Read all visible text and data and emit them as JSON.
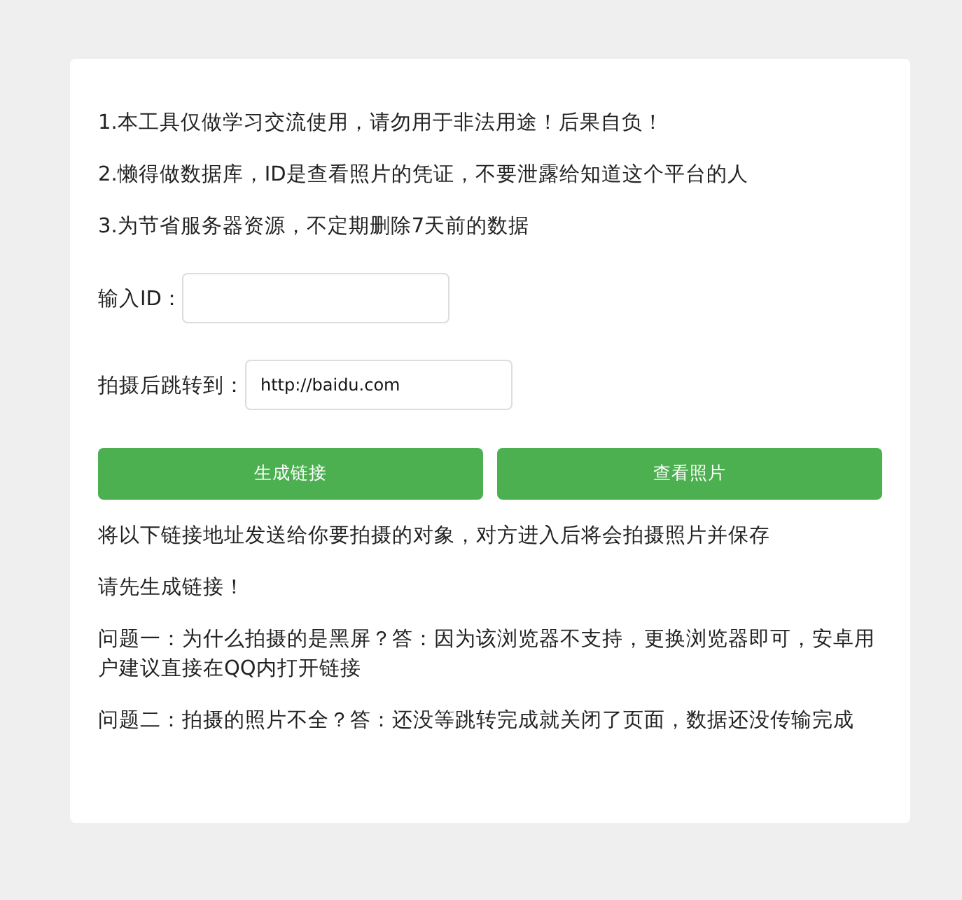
{
  "notices": [
    "1.本工具仅做学习交流使用，请勿用于非法用途！后果自负！",
    "2.懒得做数据库，ID是查看照片的凭证，不要泄露给知道这个平台的人",
    "3.为节省服务器资源，不定期删除7天前的数据"
  ],
  "fields": [
    {
      "label": "输入ID："
    },
    {
      "label": "拍摄后跳转到：",
      "value": "http://baidu.com"
    }
  ],
  "buttons": [
    "生成链接",
    "查看照片"
  ],
  "info": [
    "将以下链接地址发送给你要拍摄的对象，对方进入后将会拍摄照片并保存",
    "请先生成链接！",
    "问题一：为什么拍摄的是黑屏？答：因为该浏览器不支持，更换浏览器即可，安卓用户建议直接在QQ内打开链接",
    "问题二：拍摄的照片不全？答：还没等跳转完成就关闭了页面，数据还没传输完成"
  ]
}
